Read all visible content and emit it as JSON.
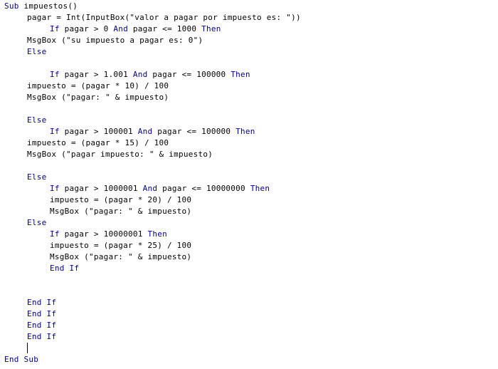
{
  "code": {
    "sub_kw": "Sub",
    "sub_name": "impuestos()",
    "l2": "pagar = Int(InputBox(\"valor a pagar por impuesto es: \"))",
    "l3_if": "If",
    "l3_mid": "pagar > 0",
    "l3_and": "And",
    "l3_rest": "pagar <= 1000",
    "l3_then": "Then",
    "l4": "MsgBox (\"su impuesto a pagar es: 0\")",
    "l5_else": "Else",
    "l7_if": "If",
    "l7_mid": "pagar > 1.001",
    "l7_and": "And",
    "l7_rest": "pagar <= 100000",
    "l7_then": "Then",
    "l8": "impuesto = (pagar * 10) / 100",
    "l9": "MsgBox (\"pagar: \" & impuesto)",
    "l11_else": "Else",
    "l12_if": "If",
    "l12_mid": "pagar > 100001",
    "l12_and": "And",
    "l12_rest": "pagar <= 100000",
    "l12_then": "Then",
    "l13": "impuesto = (pagar * 15) / 100",
    "l14": "MsgBox (\"pagar impuesto: \" & impuesto)",
    "l16_else": "Else",
    "l17_if": "If",
    "l17_mid": "pagar > 1000001",
    "l17_and": "And",
    "l17_rest": "pagar <= 10000000",
    "l17_then": "Then",
    "l18": "impuesto = (pagar * 20) / 100",
    "l19": "MsgBox (\"pagar: \" & impuesto)",
    "l20_else": "Else",
    "l21_if": "If",
    "l21_mid": "pagar > 10000001",
    "l21_then": "Then",
    "l22": "impuesto = (pagar * 25) / 100",
    "l23": "MsgBox (\"pagar: \" & impuesto)",
    "l24_endif": "End If",
    "l27_endif": "End If",
    "l28_endif": "End If",
    "l29_endif": "End If",
    "l30_endif": "End If",
    "l32_endsub": "End Sub"
  },
  "colors": {
    "keyword": "#00008b",
    "text": "#000000",
    "background": "#ffffff"
  }
}
